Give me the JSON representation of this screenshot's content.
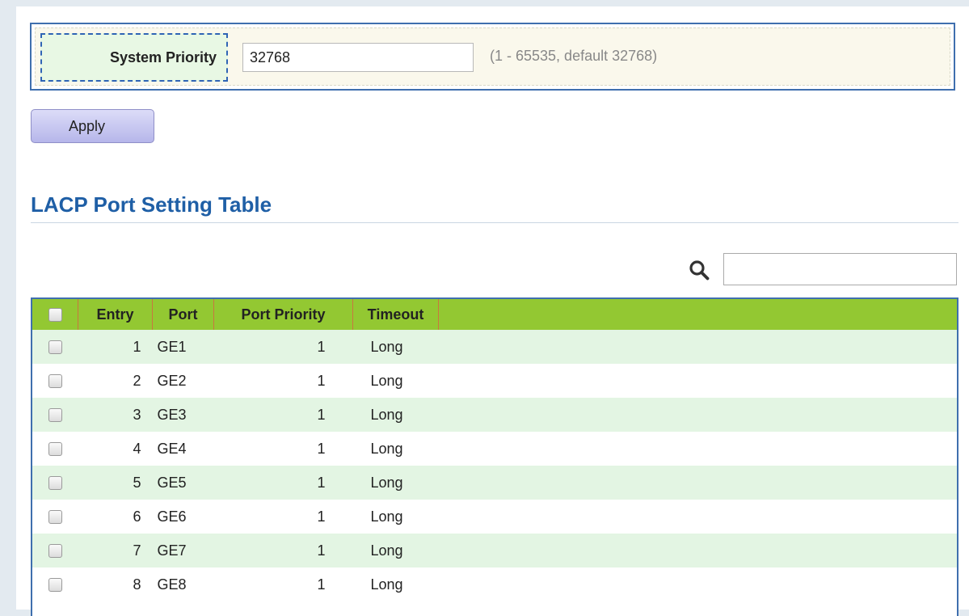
{
  "settings": {
    "system_priority_label": "System Priority",
    "system_priority_value": "32768",
    "system_priority_hint": "(1 - 65535, default 32768)",
    "apply_label": "Apply"
  },
  "section": {
    "title": "LACP Port Setting Table"
  },
  "search": {
    "icon": "search-icon",
    "value": ""
  },
  "table": {
    "headers": {
      "entry": "Entry",
      "port": "Port",
      "port_priority": "Port Priority",
      "timeout": "Timeout"
    },
    "rows": [
      {
        "entry": "1",
        "port": "GE1",
        "port_priority": "1",
        "timeout": "Long"
      },
      {
        "entry": "2",
        "port": "GE2",
        "port_priority": "1",
        "timeout": "Long"
      },
      {
        "entry": "3",
        "port": "GE3",
        "port_priority": "1",
        "timeout": "Long"
      },
      {
        "entry": "4",
        "port": "GE4",
        "port_priority": "1",
        "timeout": "Long"
      },
      {
        "entry": "5",
        "port": "GE5",
        "port_priority": "1",
        "timeout": "Long"
      },
      {
        "entry": "6",
        "port": "GE6",
        "port_priority": "1",
        "timeout": "Long"
      },
      {
        "entry": "7",
        "port": "GE7",
        "port_priority": "1",
        "timeout": "Long"
      },
      {
        "entry": "8",
        "port": "GE8",
        "port_priority": "1",
        "timeout": "Long"
      }
    ]
  },
  "colors": {
    "header_green": "#93c832",
    "row_alt": "#e3f5e3",
    "title_blue": "#1f5fa6",
    "panel_border": "#3f6fae"
  }
}
